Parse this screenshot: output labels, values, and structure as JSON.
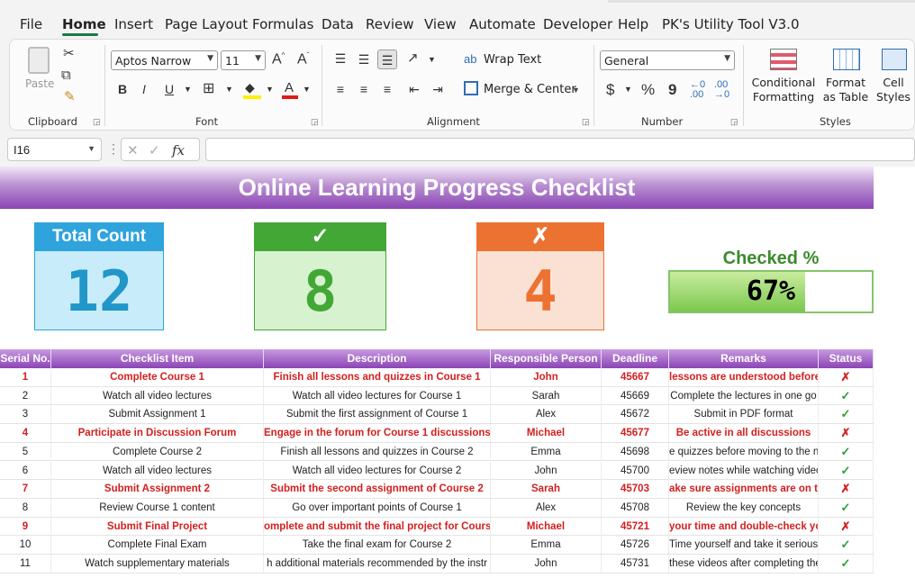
{
  "menu": {
    "tabs": [
      "File",
      "Home",
      "Insert",
      "Page Layout",
      "Formulas",
      "Data",
      "Review",
      "View",
      "Automate",
      "Developer",
      "Help",
      "PK's Utility Tool V3.0"
    ],
    "active": "Home"
  },
  "ribbon": {
    "clipboard": {
      "paste_label": "Paste",
      "group_label": "Clipboard"
    },
    "font": {
      "name": "Aptos Narrow",
      "size": "11",
      "group_label": "Font",
      "bold": "B",
      "italic": "I",
      "underline": "U"
    },
    "alignment": {
      "wrap_text": "Wrap Text",
      "merge_center": "Merge & Center",
      "group_label": "Alignment"
    },
    "number": {
      "format": "General",
      "currency": "$",
      "percent": "%",
      "comma": "9",
      "group_label": "Number"
    },
    "styles": {
      "conditional_formatting": "Conditional Formatting",
      "format_as_table": "Format as Table",
      "cell_styles": "Cell Styles",
      "group_label": "Styles"
    }
  },
  "formula_bar": {
    "name_box": "I16",
    "fx": "fx",
    "formula": ""
  },
  "sheet": {
    "title": "Online Learning Progress Checklist",
    "cards": {
      "total": {
        "label": "Total Count",
        "value": "12",
        "head_color": "#2ea3dc",
        "body_color": "#c8ecf9",
        "value_color": "#2196c9"
      },
      "checked": {
        "label": "✓",
        "value": "8",
        "head_color": "#43a736",
        "body_color": "#d7f2cf",
        "value_color": "#43a736"
      },
      "unchecked": {
        "label": "✗",
        "value": "4",
        "head_color": "#ec7232",
        "body_color": "#fbe1d3",
        "value_color": "#ec7232"
      }
    },
    "checked_percent": {
      "label": "Checked %",
      "value_text": "67%",
      "fraction": 0.67
    }
  },
  "table": {
    "headers": [
      "Serial No.",
      "Checklist Item",
      "Description",
      "Responsible Person",
      "Deadline",
      "Remarks",
      "Status"
    ],
    "rows": [
      {
        "serial": "1",
        "item": "Complete Course 1",
        "description": "Finish all lessons and quizzes in Course 1",
        "person": "John",
        "deadline": "45667",
        "remarks": "lessons are understood before s",
        "status": "✗",
        "flag": true
      },
      {
        "serial": "2",
        "item": "Watch all video lectures",
        "description": "Watch all video lectures for Course 1",
        "person": "Sarah",
        "deadline": "45669",
        "remarks": "Complete the lectures in one go",
        "status": "✓",
        "flag": false
      },
      {
        "serial": "3",
        "item": "Submit Assignment 1",
        "description": "Submit the first assignment of Course 1",
        "person": "Alex",
        "deadline": "45672",
        "remarks": "Submit in PDF format",
        "status": "✓",
        "flag": false
      },
      {
        "serial": "4",
        "item": "Participate in Discussion Forum",
        "description": "Engage in the forum for Course 1 discussions",
        "person": "Michael",
        "deadline": "45677",
        "remarks": "Be active in all discussions",
        "status": "✗",
        "flag": true
      },
      {
        "serial": "5",
        "item": "Complete Course 2",
        "description": "Finish all lessons and quizzes in Course 2",
        "person": "Emma",
        "deadline": "45698",
        "remarks": "e quizzes before moving to the ne",
        "status": "✓",
        "flag": false
      },
      {
        "serial": "6",
        "item": "Watch all video lectures",
        "description": "Watch all video lectures for Course 2",
        "person": "John",
        "deadline": "45700",
        "remarks": "eview notes while watching videc",
        "status": "✓",
        "flag": false
      },
      {
        "serial": "7",
        "item": "Submit Assignment 2",
        "description": "Submit the second assignment of Course 2",
        "person": "Sarah",
        "deadline": "45703",
        "remarks": "ake sure assignments are on tim",
        "status": "✗",
        "flag": true
      },
      {
        "serial": "8",
        "item": "Review Course 1 content",
        "description": "Go over important points of Course 1",
        "person": "Alex",
        "deadline": "45708",
        "remarks": "Review the key concepts",
        "status": "✓",
        "flag": false
      },
      {
        "serial": "9",
        "item": "Submit Final Project",
        "description": "omplete and submit the final project for Course",
        "person": "Michael",
        "deadline": "45721",
        "remarks": "your time and double-check your",
        "status": "✗",
        "flag": true
      },
      {
        "serial": "10",
        "item": "Complete Final Exam",
        "description": "Take the final exam for Course 2",
        "person": "Emma",
        "deadline": "45726",
        "remarks": "Time yourself and take it serious",
        "status": "✓",
        "flag": false
      },
      {
        "serial": "11",
        "item": "Watch supplementary materials",
        "description": "h additional materials recommended by the instr",
        "person": "John",
        "deadline": "45731",
        "remarks": "these videos after completing the",
        "status": "✓",
        "flag": false
      }
    ]
  }
}
